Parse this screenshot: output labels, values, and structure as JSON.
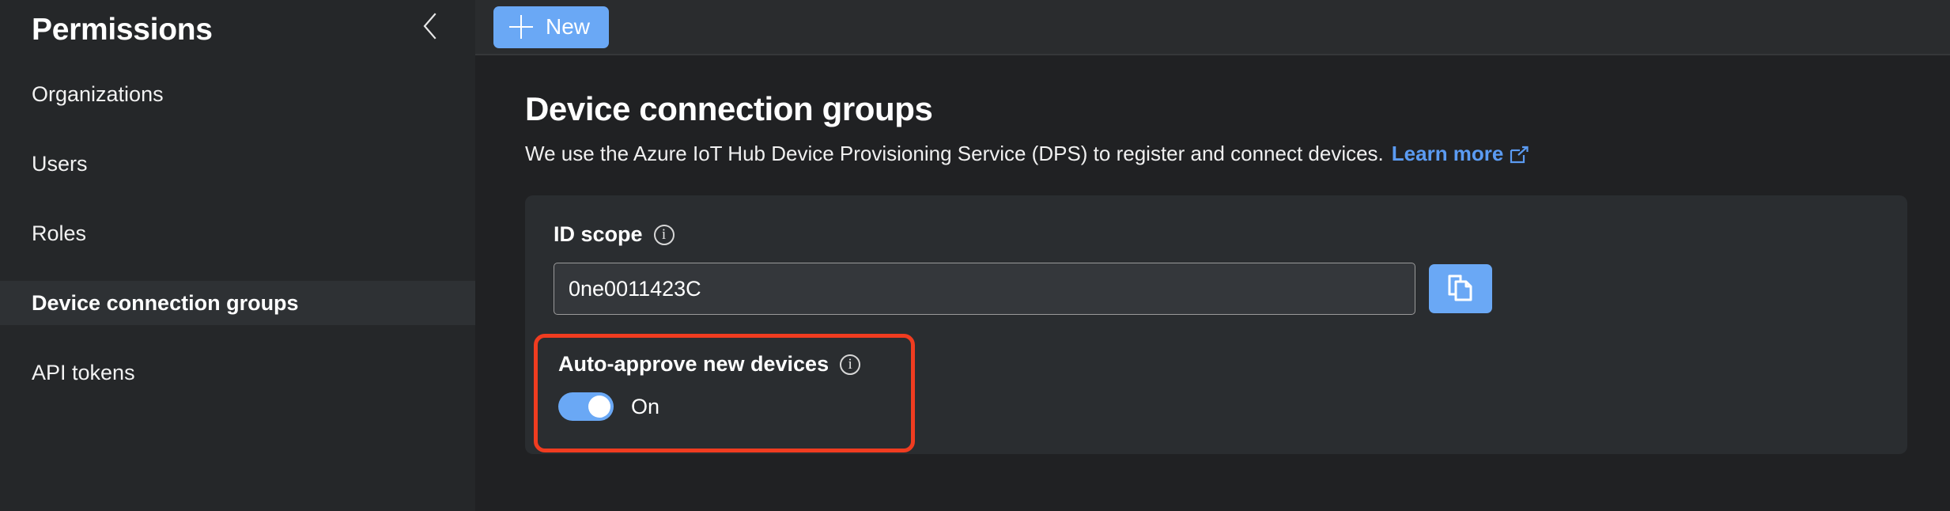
{
  "sidebar": {
    "title": "Permissions",
    "collapse_icon": "chevron-left-icon",
    "items": [
      {
        "label": "Organizations",
        "active": false
      },
      {
        "label": "Users",
        "active": false
      },
      {
        "label": "Roles",
        "active": false
      },
      {
        "label": "Device connection groups",
        "active": true
      },
      {
        "label": "API tokens",
        "active": false
      }
    ]
  },
  "toolbar": {
    "new_label": "New",
    "new_icon": "plus-icon"
  },
  "main": {
    "page_title": "Device connection groups",
    "description": "We use the Azure IoT Hub Device Provisioning Service (DPS) to register and connect devices.",
    "learn_more_label": "Learn more",
    "learn_more_icon": "external-link-icon"
  },
  "card": {
    "id_scope": {
      "label": "ID scope",
      "info_icon": "info-icon",
      "info_glyph": "i",
      "value": "0ne0011423C",
      "placeholder": "ID scope",
      "copy_icon": "copy-icon"
    },
    "auto_approve": {
      "label": "Auto-approve new devices",
      "info_icon": "info-icon",
      "info_glyph": "i",
      "state_label": "On",
      "enabled": true
    }
  },
  "colors": {
    "accent_blue": "#6aa8f5",
    "link_blue": "#5b9bf2",
    "highlight_red": "#f03c20",
    "sidebar_bg": "#252729",
    "main_bg": "#202123",
    "card_bg": "#2a2d30",
    "active_item_bg": "#2e3134"
  }
}
